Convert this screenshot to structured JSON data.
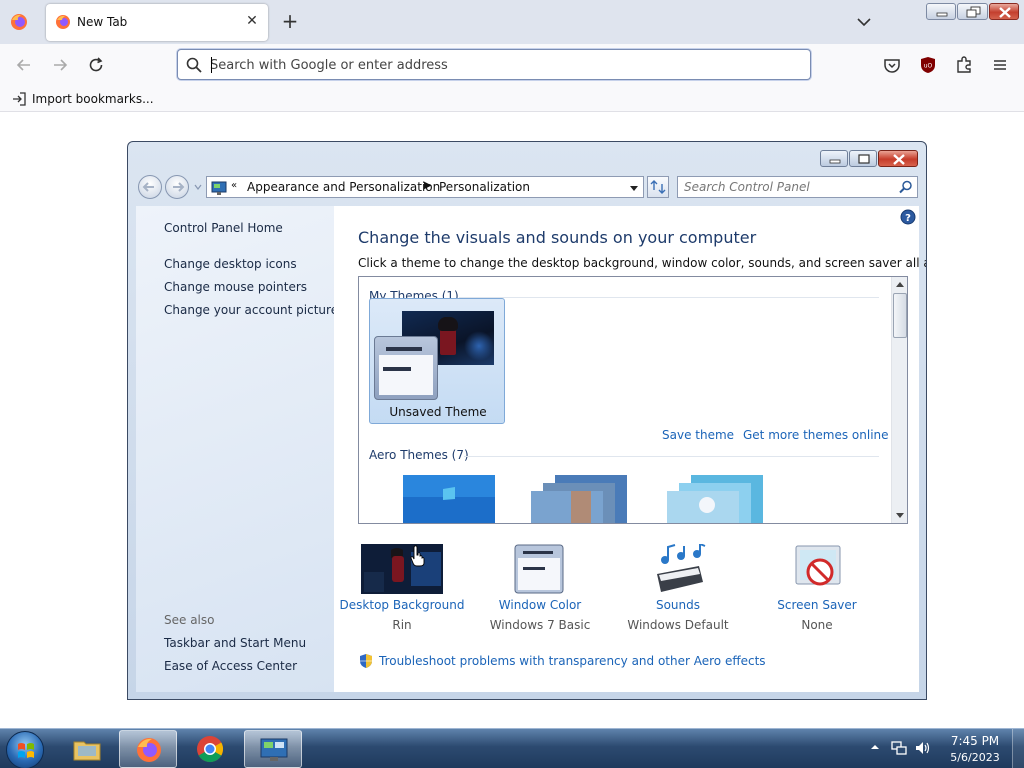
{
  "browser": {
    "tab_title": "New Tab",
    "url_placeholder": "Search with Google or enter address",
    "bookmark_import": "Import bookmarks..."
  },
  "control_panel": {
    "breadcrumb": [
      "Appearance and Personalization",
      "Personalization"
    ],
    "search_placeholder": "Search Control Panel",
    "sidebar": {
      "home": "Control Panel Home",
      "links": [
        "Change desktop icons",
        "Change mouse pointers",
        "Change your account picture"
      ],
      "see_also_title": "See also",
      "see_also": [
        "Taskbar and Start Menu",
        "Ease of Access Center"
      ]
    },
    "heading": "Change the visuals and sounds on your computer",
    "subtext": "Click a theme to change the desktop background, window color, sounds, and screen saver all at once.",
    "groups": {
      "my_themes": "My Themes (1)",
      "aero_themes": "Aero Themes (7)"
    },
    "selected_theme": "Unsaved Theme",
    "save_theme": "Save theme",
    "get_more_themes": "Get more themes online",
    "customize": [
      {
        "label": "Desktop Background",
        "value": "Rin"
      },
      {
        "label": "Window Color",
        "value": "Windows 7 Basic"
      },
      {
        "label": "Sounds",
        "value": "Windows Default"
      },
      {
        "label": "Screen Saver",
        "value": "None"
      }
    ],
    "troubleshoot": "Troubleshoot problems with transparency and other Aero effects"
  },
  "taskbar": {
    "time": "7:45 PM",
    "date": "5/6/2023"
  },
  "colors": {
    "link": "#1b64b8",
    "heading": "#1e3b6b",
    "taskbar": "#2c4a70"
  }
}
